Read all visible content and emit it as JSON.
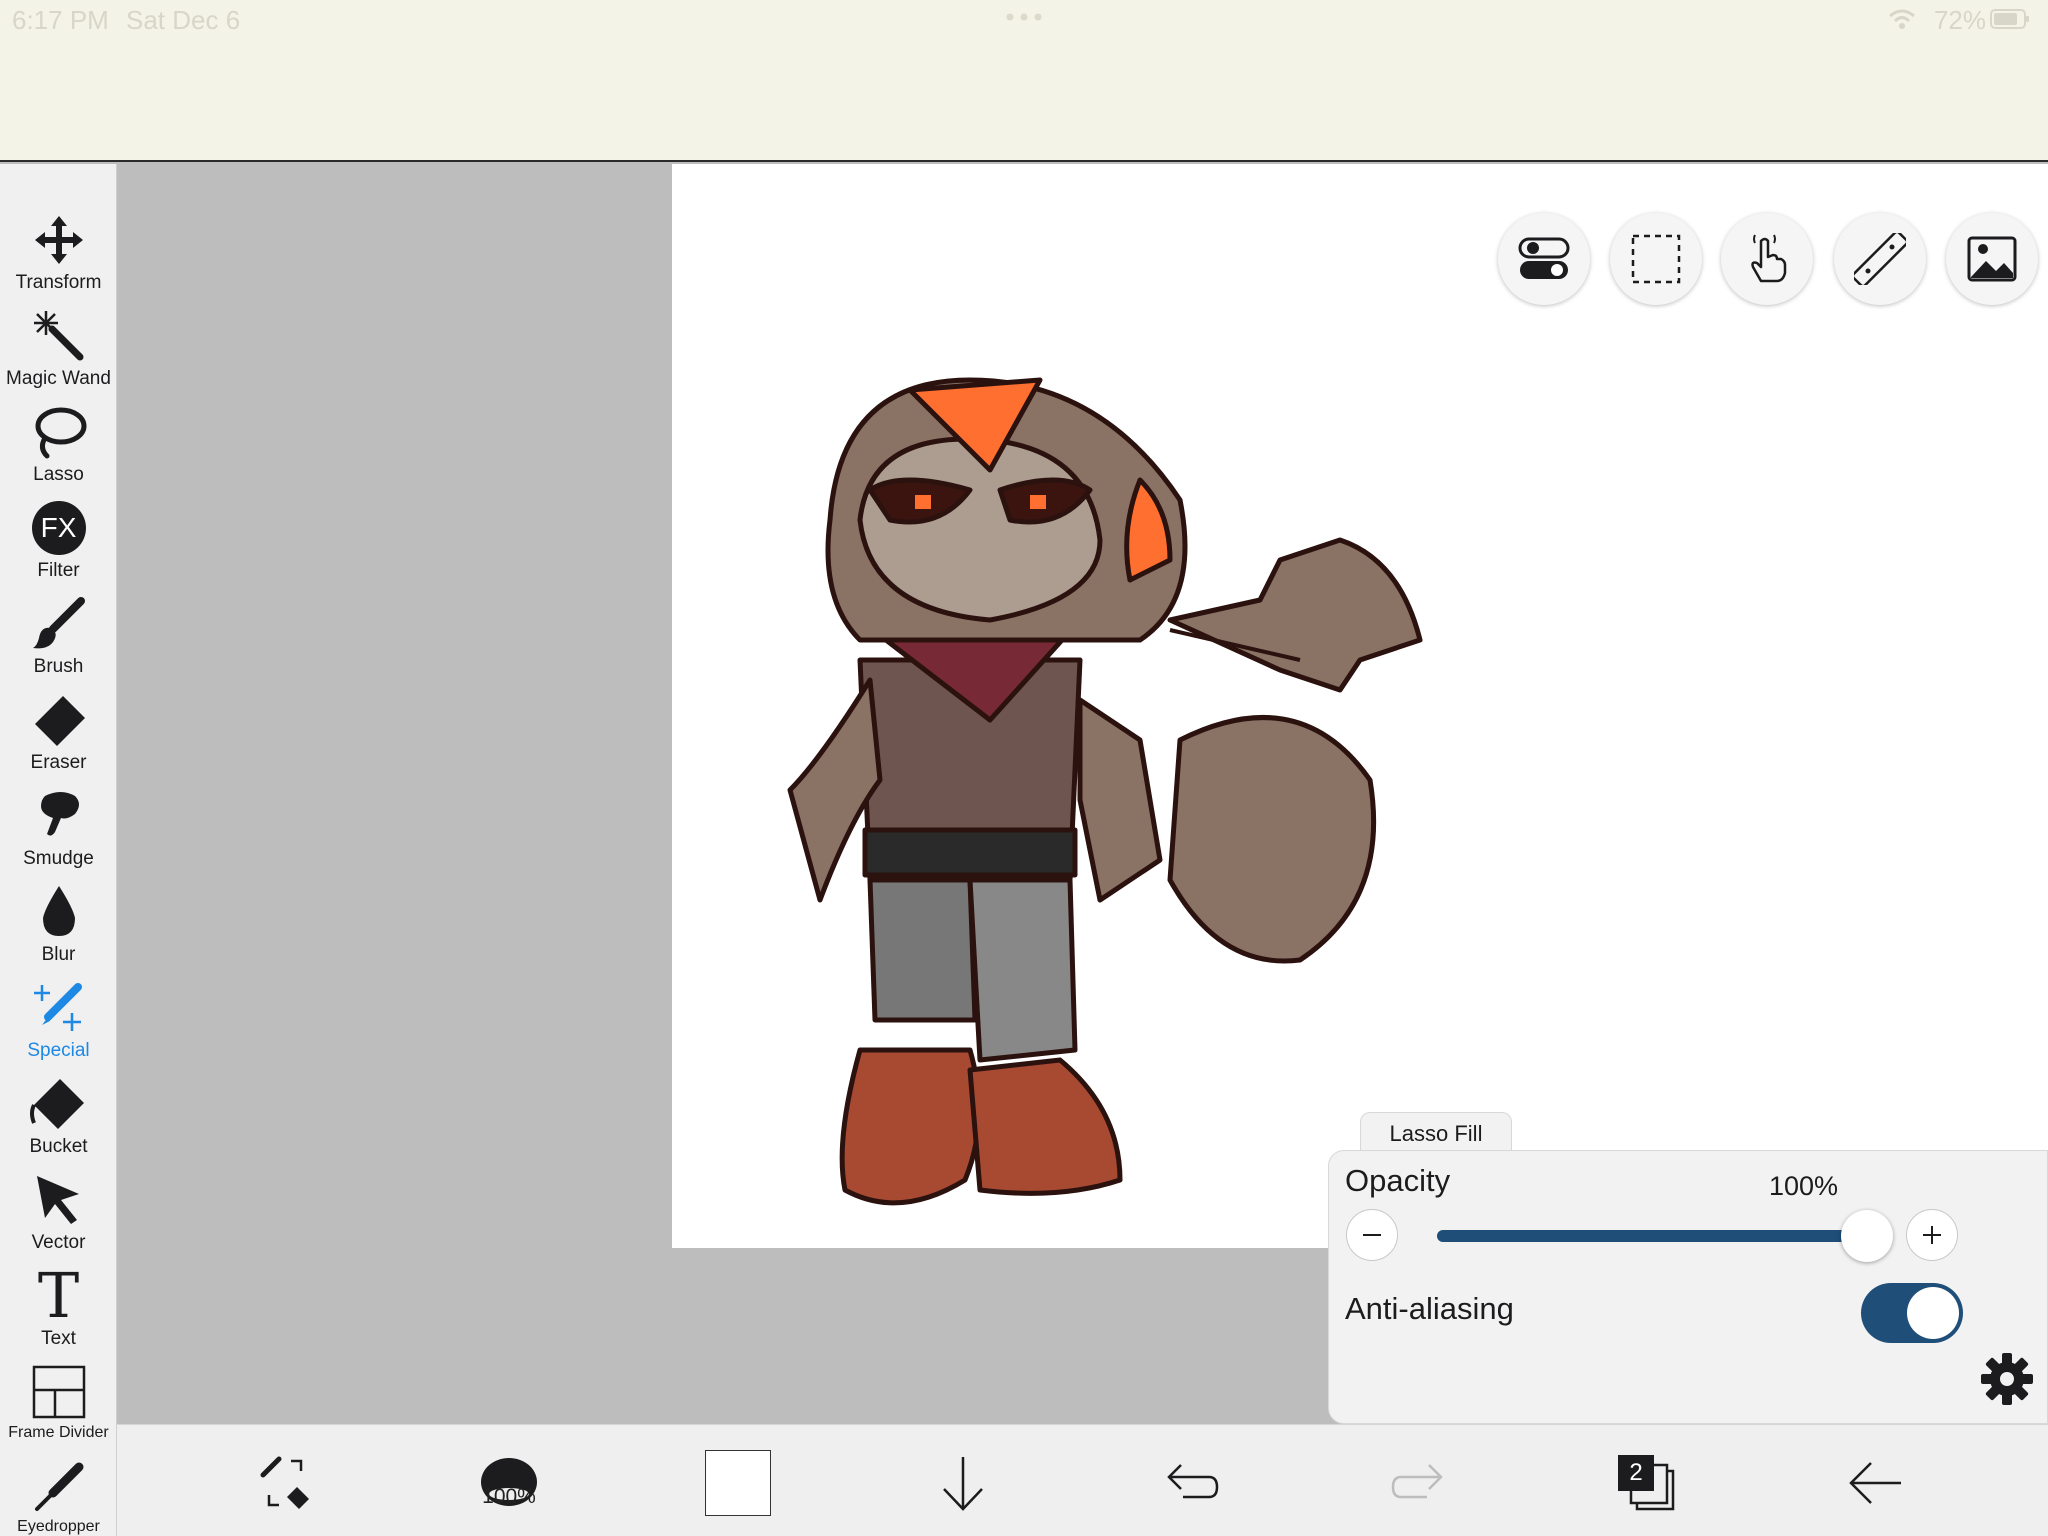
{
  "status_bar": {
    "time": "6:17 PM",
    "date": "Sat Dec 6",
    "battery": "72%"
  },
  "toolbar": {
    "tools": [
      {
        "label": "Transform",
        "icon": "move-arrows-icon"
      },
      {
        "label": "Magic Wand",
        "icon": "magic-wand-icon"
      },
      {
        "label": "Lasso",
        "icon": "lasso-icon"
      },
      {
        "label": "Filter",
        "icon": "fx-icon",
        "icon_text": "FX"
      },
      {
        "label": "Brush",
        "icon": "brush-icon"
      },
      {
        "label": "Eraser",
        "icon": "eraser-icon"
      },
      {
        "label": "Smudge",
        "icon": "smudge-icon"
      },
      {
        "label": "Blur",
        "icon": "drop-icon"
      },
      {
        "label": "Special",
        "icon": "special-pen-icon",
        "active": true
      },
      {
        "label": "Bucket",
        "icon": "bucket-icon"
      },
      {
        "label": "Vector",
        "icon": "cursor-arrow-icon"
      },
      {
        "label": "Text",
        "icon": "text-t-icon",
        "icon_text": "T"
      },
      {
        "label": "Frame Divider",
        "icon": "frame-divider-icon"
      },
      {
        "label": "Eyedropper",
        "icon": "eyedropper-icon"
      }
    ],
    "active_color": "#1e88e5"
  },
  "quick_buttons": [
    {
      "name": "toggle-switches-icon"
    },
    {
      "name": "selection-rect-icon"
    },
    {
      "name": "touch-hand-icon"
    },
    {
      "name": "ruler-icon"
    },
    {
      "name": "image-import-icon"
    }
  ],
  "lasso_panel": {
    "tab_label": "Lasso Fill",
    "opacity_label": "Opacity",
    "opacity_value": "100%",
    "opacity_level": 1.0,
    "anti_aliasing_label": "Anti-aliasing",
    "anti_aliasing_on": true,
    "accent": "#1f4e79"
  },
  "bottom_bar": {
    "brush_size_text": "100%",
    "current_color": "#ffffff",
    "layer_count": "2"
  }
}
